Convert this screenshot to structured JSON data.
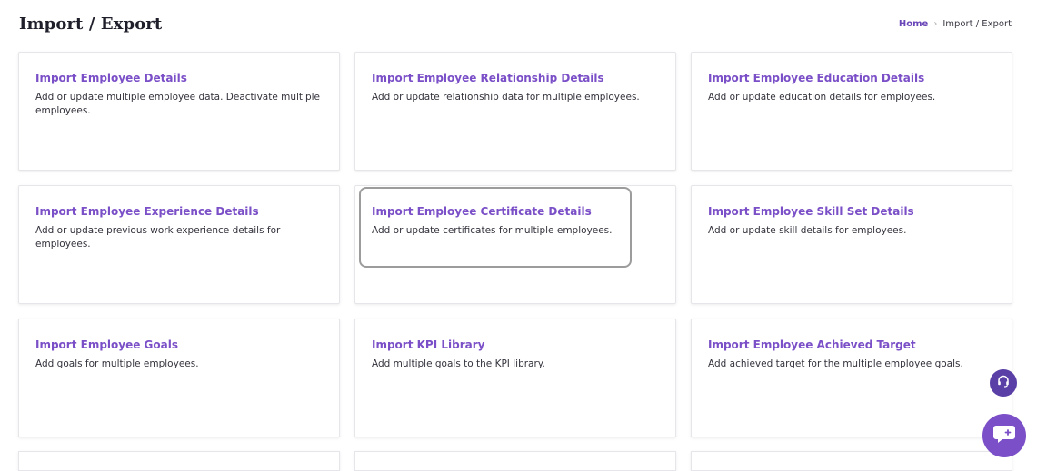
{
  "header": {
    "title": "Import / Export"
  },
  "breadcrumb": {
    "home": "Home",
    "separator": "›",
    "current": "Import / Export"
  },
  "cards": [
    {
      "title": "Import Employee Details",
      "description": "Add or update multiple employee data. Deactivate multiple employees."
    },
    {
      "title": "Import Employee Relationship Details",
      "description": "Add or update relationship data for multiple employees."
    },
    {
      "title": "Import Employee Education Details",
      "description": "Add or update education details for employees."
    },
    {
      "title": "Import Employee Experience Details",
      "description": "Add or update previous work experience details for employees."
    },
    {
      "title": "Import Employee Certificate Details",
      "description": "Add or update certificates for multiple employees."
    },
    {
      "title": "Import Employee Skill Set Details",
      "description": "Add or update skill details for employees."
    },
    {
      "title": "Import Employee Goals",
      "description": "Add goals for multiple employees."
    },
    {
      "title": "Import KPI Library",
      "description": "Add multiple goals to the KPI library."
    },
    {
      "title": "Import Employee Achieved Target",
      "description": "Add achieved target for the multiple employee goals."
    }
  ],
  "floating": {
    "help_icon": "headset-icon",
    "chat_icon": "chat-icon"
  },
  "colors": {
    "accent": "#7a4fc7",
    "help_button": "#5a3fa6",
    "chat_button": "#7b4fc7",
    "focus_ring": "#9c9c9c"
  }
}
